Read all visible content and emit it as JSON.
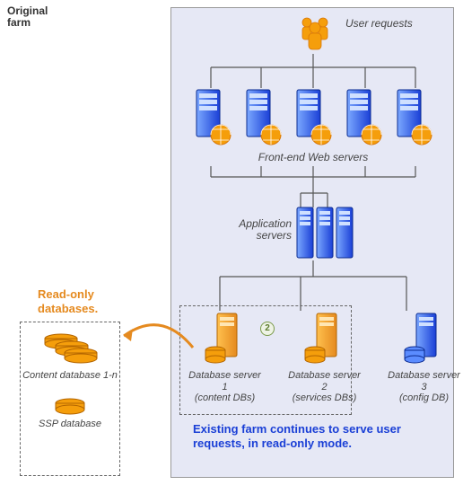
{
  "farm": {
    "title": "Original farm",
    "user_label": "User requests",
    "web_label": "Front-end Web servers",
    "app_label": "Application servers",
    "db": [
      {
        "name": "Database server 1",
        "sub": "(content DBs)"
      },
      {
        "name": "Database server 2",
        "sub": "(services DBs)"
      },
      {
        "name": "Database server 3",
        "sub": "(config DB)"
      }
    ],
    "caption": "Existing farm continues to serve user requests, in read-only mode.",
    "step_badge": "2"
  },
  "readonly": {
    "title": "Read-only databases.",
    "content_db": "Content database 1-n",
    "ssp_db": "SSP database"
  },
  "colors": {
    "blue_dark": "#1a3fd6",
    "orange": "#f59e0b",
    "orange_dark": "#e58a1f"
  }
}
